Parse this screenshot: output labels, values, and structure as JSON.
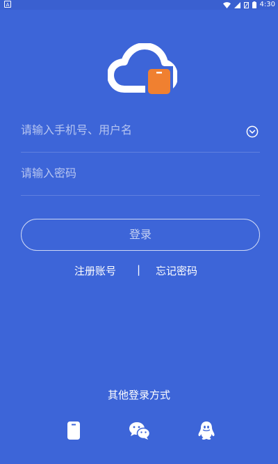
{
  "status_bar": {
    "left_icon_letter": "A",
    "time": "4:30",
    "icons": [
      "wifi-icon",
      "signal-icon",
      "sim-icon",
      "battery-icon"
    ]
  },
  "logo": {
    "icon": "cloud-phone-logo-icon",
    "cloud_color": "#ffffff",
    "phone_color": "#f08030"
  },
  "form": {
    "username_placeholder": "请输入手机号、用户名",
    "username_value": "",
    "dropdown_icon": "chevron-down-circle-icon",
    "password_placeholder": "请输入密码",
    "password_value": ""
  },
  "login_button": {
    "label": "登录"
  },
  "links": {
    "register": "注册账号",
    "divider": "|",
    "forgot": "忘记密码"
  },
  "other_login": {
    "title": "其他登录方式",
    "methods": [
      "phone-icon",
      "wechat-icon",
      "qq-icon"
    ]
  },
  "colors": {
    "background": "#3d65d8",
    "accent": "#f08030",
    "text": "#ffffff"
  }
}
